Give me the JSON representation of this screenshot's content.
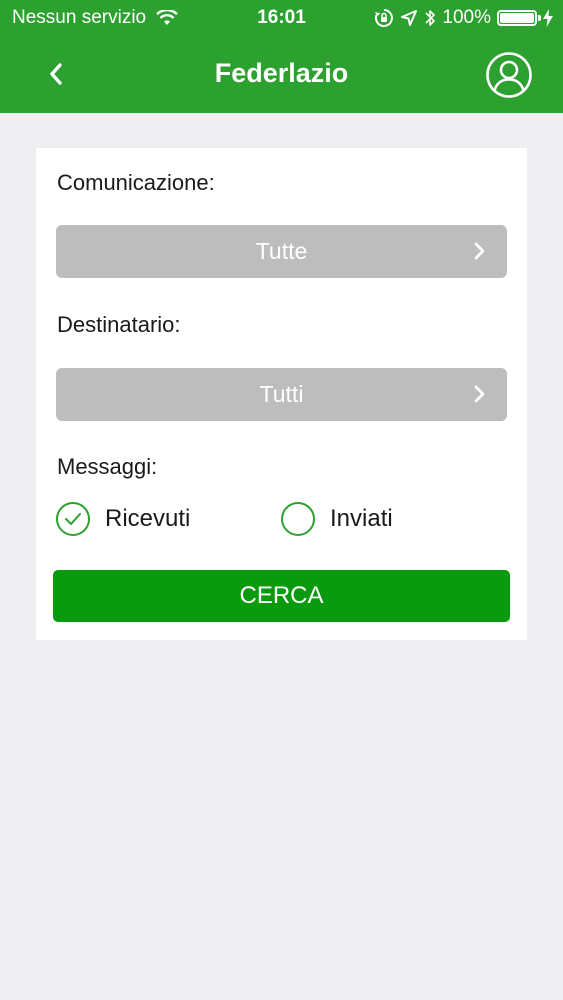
{
  "status_bar": {
    "carrier": "Nessun servizio",
    "time": "16:01",
    "battery": "100%",
    "battery_level": 1.0,
    "icons": [
      "wifi-icon",
      "rotation-lock-icon",
      "location-arrow-icon",
      "bluetooth-icon",
      "battery-icon",
      "charging-bolt-icon"
    ]
  },
  "nav": {
    "title": "Federlazio",
    "back_icon": "chevron-left-icon",
    "profile_icon": "user-profile-icon"
  },
  "form": {
    "comunicazione_label": "Comunicazione:",
    "comunicazione_value": "Tutte",
    "destinatario_label": "Destinatario:",
    "destinatario_value": "Tutti",
    "messaggi_label": "Messaggi:",
    "radio_ricevuti": "Ricevuti",
    "radio_inviati": "Inviati",
    "selected_radio": "Ricevuti",
    "search_button": "CERCA"
  },
  "colors": {
    "header": "#2da12f",
    "button": "#0a9a0e",
    "select": "#bdbdbd",
    "background": "#efeff1"
  }
}
